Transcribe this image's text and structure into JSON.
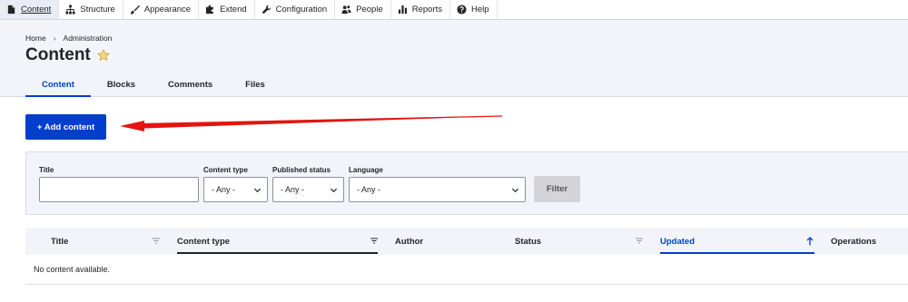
{
  "toolbar": {
    "items": [
      {
        "label": "Content",
        "icon": "file-icon",
        "active": true
      },
      {
        "label": "Structure",
        "icon": "sitemap-icon"
      },
      {
        "label": "Appearance",
        "icon": "brush-icon"
      },
      {
        "label": "Extend",
        "icon": "puzzle-icon"
      },
      {
        "label": "Configuration",
        "icon": "wrench-icon"
      },
      {
        "label": "People",
        "icon": "people-icon"
      },
      {
        "label": "Reports",
        "icon": "bar-chart-icon"
      },
      {
        "label": "Help",
        "icon": "help-icon"
      }
    ]
  },
  "breadcrumb": {
    "home": "Home",
    "separator": "›",
    "admin": "Administration"
  },
  "page": {
    "title": "Content"
  },
  "tabs": [
    {
      "label": "Content",
      "active": true
    },
    {
      "label": "Blocks"
    },
    {
      "label": "Comments"
    },
    {
      "label": "Files"
    }
  ],
  "actions": {
    "add_content": "+ Add content"
  },
  "filters": {
    "title_label": "Title",
    "title_value": "",
    "content_type_label": "Content type",
    "content_type_value": "- Any -",
    "published_label": "Published status",
    "published_value": "- Any -",
    "language_label": "Language",
    "language_value": "- Any -",
    "filter_button": "Filter"
  },
  "table": {
    "columns": {
      "title": "Title",
      "content_type": "Content type",
      "author": "Author",
      "status": "Status",
      "updated": "Updated",
      "operations": "Operations"
    },
    "empty": "No content available."
  },
  "colors": {
    "accent": "#003ecc",
    "annotation_arrow": "#e3150e",
    "star": "#e3b82d"
  }
}
